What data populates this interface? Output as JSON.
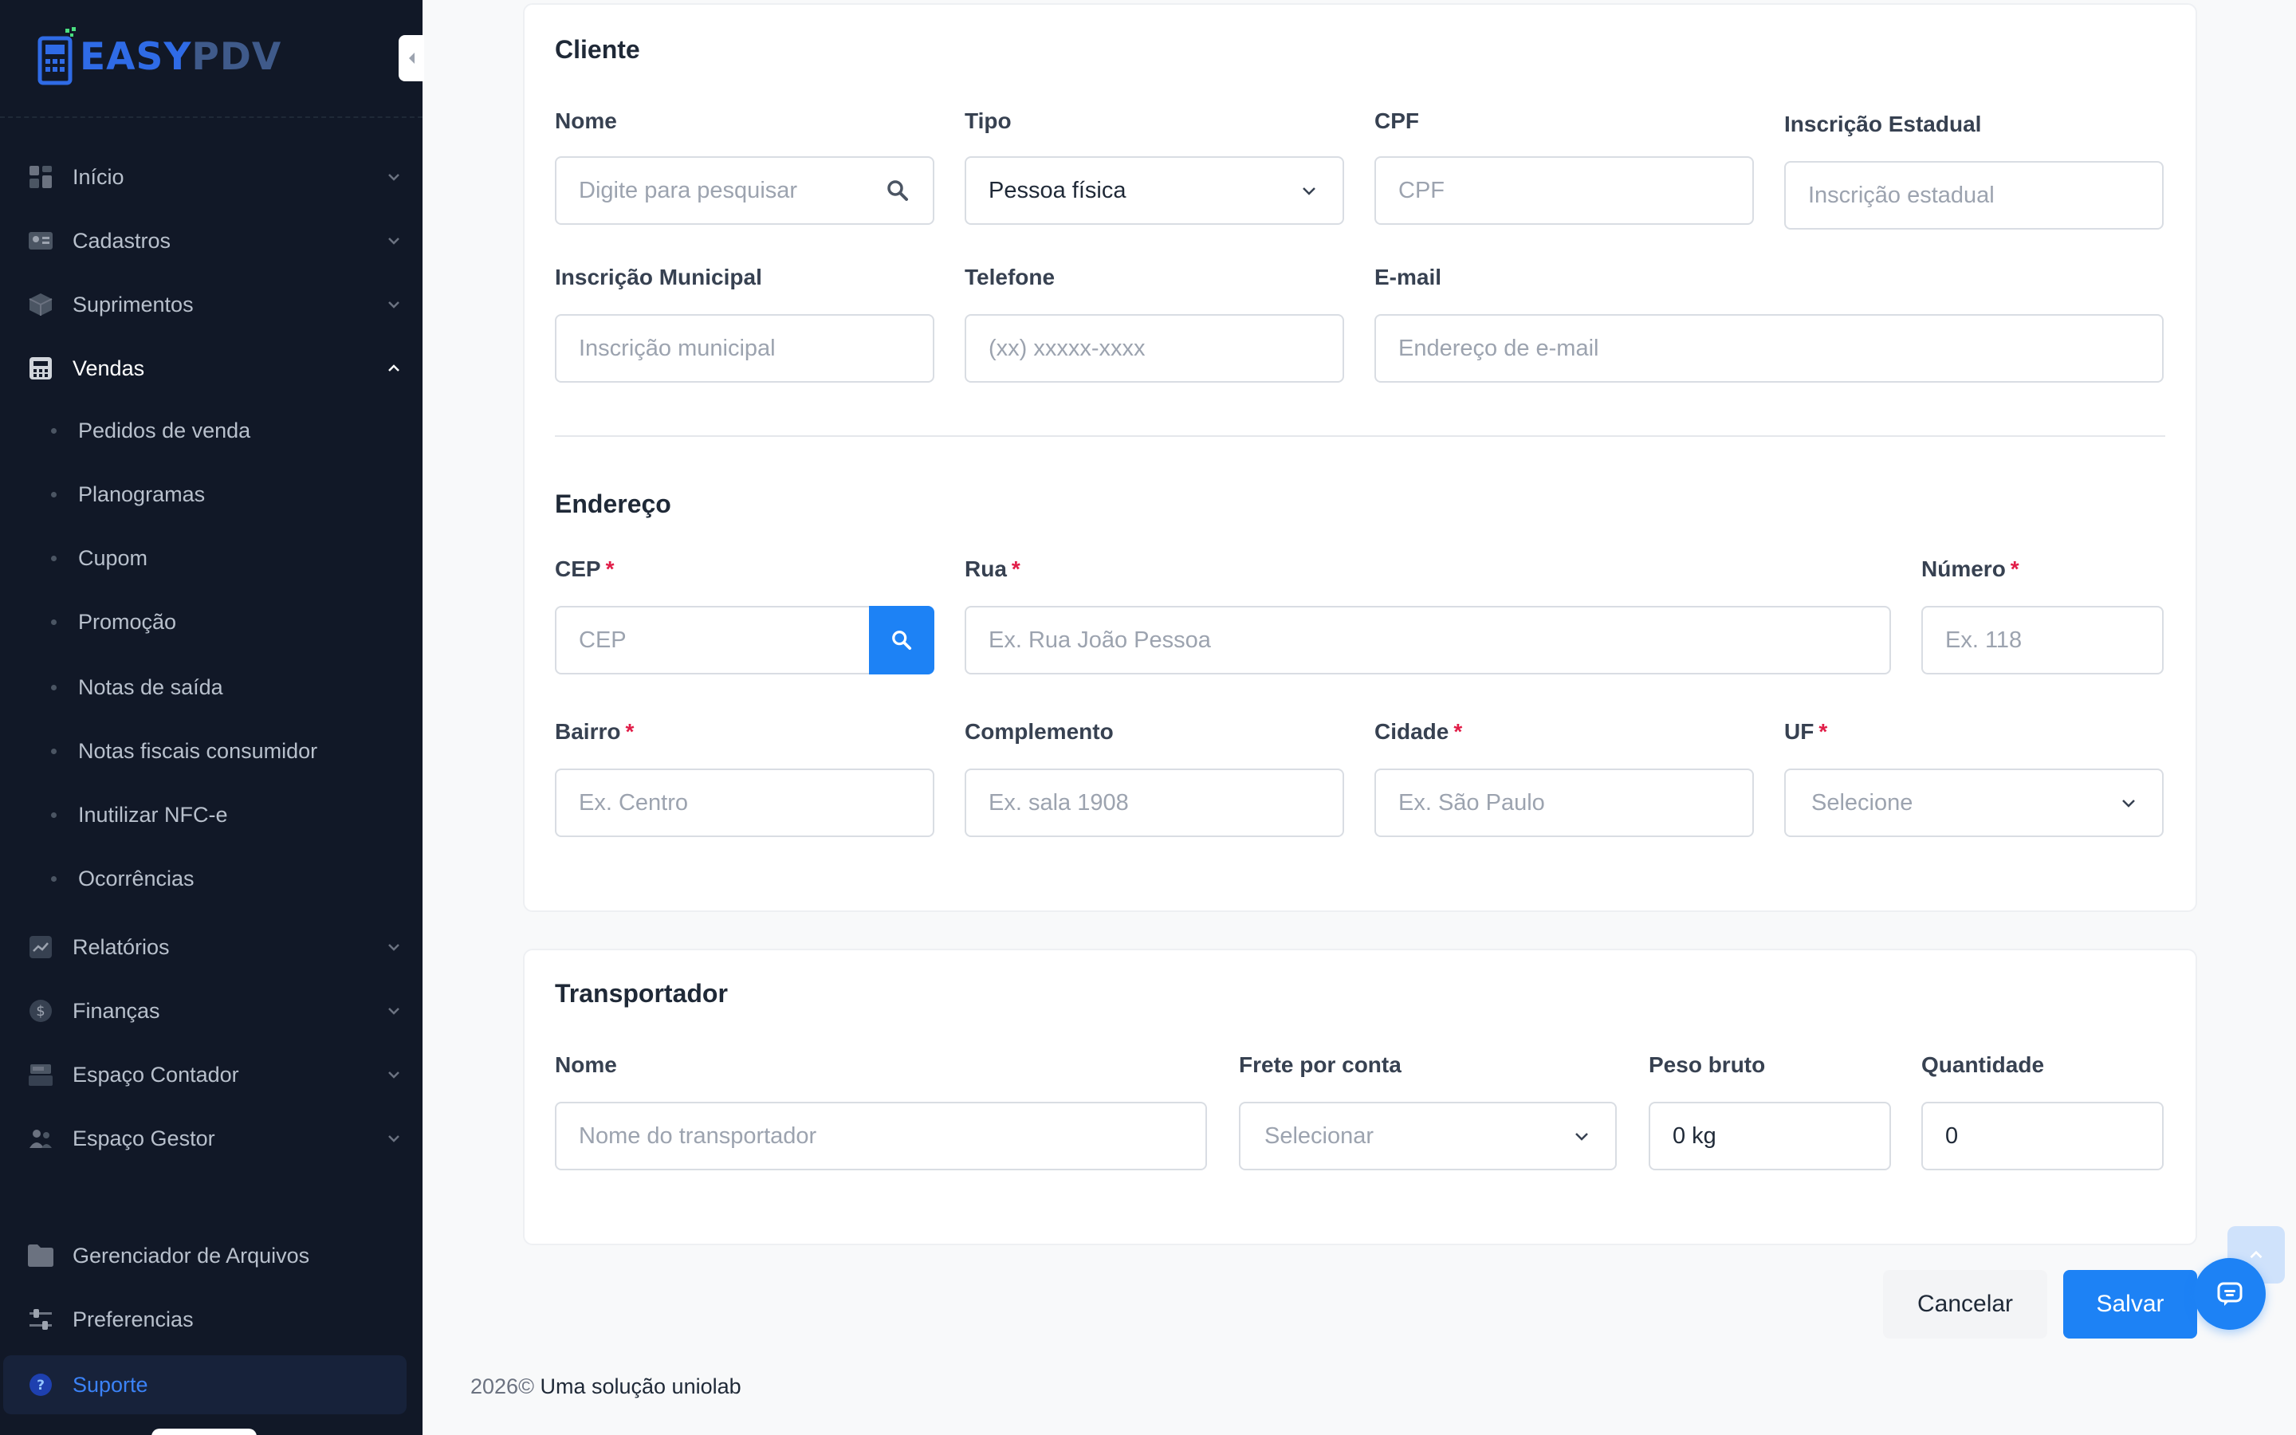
{
  "app": {
    "brand_easy": "EASY",
    "brand_pdv": "PDV"
  },
  "sidebar": {
    "items": [
      {
        "label": "Início",
        "icon": "dashboard-icon"
      },
      {
        "label": "Cadastros",
        "icon": "id-card-icon"
      },
      {
        "label": "Suprimentos",
        "icon": "box-icon"
      },
      {
        "label": "Vendas",
        "icon": "calculator-icon",
        "expanded": true
      },
      {
        "label": "Relatórios",
        "icon": "chart-icon"
      },
      {
        "label": "Finanças",
        "icon": "dollar-icon"
      },
      {
        "label": "Espaço Contador",
        "icon": "cash-register-icon"
      },
      {
        "label": "Espaço Gestor",
        "icon": "users-icon"
      }
    ],
    "vendas_sub": [
      "Pedidos de venda",
      "Planogramas",
      "Cupom",
      "Promoção",
      "Notas de saída",
      "Notas fiscais consumidor",
      "Inutilizar NFC-e",
      "Ocorrências"
    ],
    "bottom": [
      {
        "label": "Gerenciador de Arquivos",
        "icon": "folder-icon"
      },
      {
        "label": "Preferencias",
        "icon": "sliders-icon"
      },
      {
        "label": "Suporte",
        "icon": "help-icon",
        "active": true
      }
    ]
  },
  "cliente": {
    "title": "Cliente",
    "nome": {
      "label": "Nome",
      "placeholder": "Digite para pesquisar"
    },
    "tipo": {
      "label": "Tipo",
      "value": "Pessoa física"
    },
    "cpf": {
      "label": "CPF",
      "placeholder": "CPF"
    },
    "ie": {
      "label": "Inscrição Estadual",
      "placeholder": "Inscrição estadual"
    },
    "im": {
      "label": "Inscrição Municipal",
      "placeholder": "Inscrição municipal"
    },
    "telefone": {
      "label": "Telefone",
      "placeholder": "(xx) xxxxx-xxxx"
    },
    "email": {
      "label": "E-mail",
      "placeholder": "Endereço de e-mail"
    }
  },
  "endereco": {
    "title": "Endereço",
    "required_mark": "*",
    "cep": {
      "label": "CEP",
      "placeholder": "CEP"
    },
    "rua": {
      "label": "Rua",
      "placeholder": "Ex. Rua João Pessoa"
    },
    "numero": {
      "label": "Número",
      "placeholder": "Ex. 118"
    },
    "bairro": {
      "label": "Bairro",
      "placeholder": "Ex. Centro"
    },
    "complemento": {
      "label": "Complemento",
      "placeholder": "Ex. sala 1908"
    },
    "cidade": {
      "label": "Cidade",
      "placeholder": "Ex. São Paulo"
    },
    "uf": {
      "label": "UF",
      "placeholder": "Selecione"
    }
  },
  "transportador": {
    "title": "Transportador",
    "nome": {
      "label": "Nome",
      "placeholder": "Nome do transportador"
    },
    "frete": {
      "label": "Frete por conta",
      "placeholder": "Selecionar"
    },
    "peso": {
      "label": "Peso bruto",
      "value": "0 kg"
    },
    "quantidade": {
      "label": "Quantidade",
      "value": "0"
    }
  },
  "actions": {
    "cancel": "Cancelar",
    "save": "Salvar"
  },
  "footer": {
    "year": "2026©",
    "text": "Uma solução uniolab"
  },
  "colors": {
    "sidebar_bg": "#111827",
    "primary": "#1d82f5",
    "required": "#e11d48"
  }
}
